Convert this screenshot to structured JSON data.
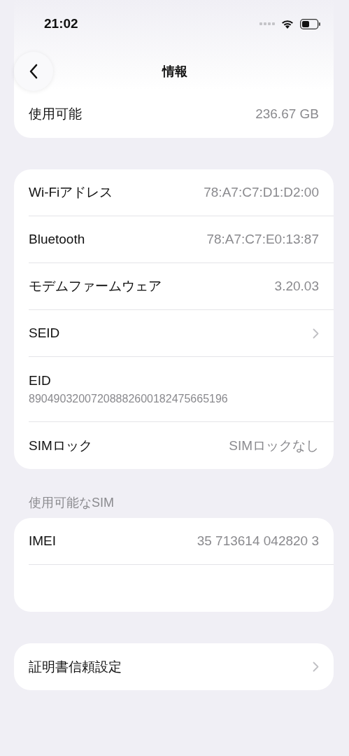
{
  "status_bar": {
    "time": "21:02"
  },
  "nav": {
    "title": "情報"
  },
  "sections": [
    {
      "rows": [
        {
          "kind": "value",
          "label": "使用可能",
          "value": "236.67 GB"
        }
      ]
    },
    {
      "rows": [
        {
          "kind": "value",
          "label": "Wi-Fiアドレス",
          "value": "78:A7:C7:D1:D2:00"
        },
        {
          "kind": "value",
          "label": "Bluetooth",
          "value": "78:A7:C7:E0:13:87"
        },
        {
          "kind": "value",
          "label": "モデムファームウェア",
          "value": "3.20.03"
        },
        {
          "kind": "link",
          "label": "SEID"
        },
        {
          "kind": "stacked",
          "label": "EID",
          "value": "89049032007208882600182475665196"
        },
        {
          "kind": "value",
          "label": "SIMロック",
          "value": "SIMロックなし"
        }
      ]
    },
    {
      "header": "使用可能なSIM",
      "rows": [
        {
          "kind": "value",
          "label": "IMEI",
          "value": "35 713614 042820 3"
        },
        {
          "kind": "blurred"
        }
      ]
    },
    {
      "rows": [
        {
          "kind": "link",
          "label": "証明書信頼設定"
        }
      ]
    }
  ]
}
